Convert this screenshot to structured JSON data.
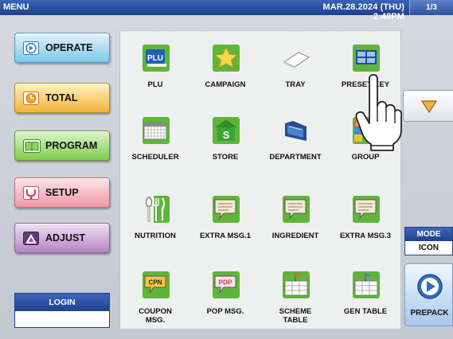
{
  "topbar": {
    "menu_label": "MENU",
    "datetime": "MAR.28.2024 (THU)  2:48PM",
    "page_indicator": "1/3"
  },
  "nav": {
    "operate": "OPERATE",
    "total": "TOTAL",
    "program": "PROGRAM",
    "setup": "SETUP",
    "adjust": "ADJUST"
  },
  "login": {
    "label": "LOGIN",
    "value": ""
  },
  "menu_items": [
    {
      "label": "PLU",
      "icon": "plu-icon",
      "icon_text": "PLU"
    },
    {
      "label": "CAMPAIGN",
      "icon": "star-icon"
    },
    {
      "label": "TRAY",
      "icon": "tray-icon"
    },
    {
      "label": "PRESET KEY",
      "icon": "preset-key-icon"
    },
    {
      "label": "SCHEDULER",
      "icon": "calendar-icon"
    },
    {
      "label": "STORE",
      "icon": "store-icon",
      "icon_text": "S"
    },
    {
      "label": "DEPARTMENT",
      "icon": "folder-icon"
    },
    {
      "label": "GROUP",
      "icon": "group-icon",
      "icon_text": "G"
    },
    {
      "label": "NUTRITION",
      "icon": "cutlery-icon"
    },
    {
      "label": "EXTRA MSG.1",
      "icon": "message-icon"
    },
    {
      "label": "INGREDIENT",
      "icon": "message-icon"
    },
    {
      "label": "EXTRA MSG.3",
      "icon": "message-icon"
    },
    {
      "label": "COUPON\nMSG.",
      "icon": "coupon-icon",
      "icon_text": "CPN"
    },
    {
      "label": "POP MSG.",
      "icon": "pop-icon",
      "icon_text": "POP"
    },
    {
      "label": "SCHEME\nTABLE",
      "icon": "scheme-table-icon"
    },
    {
      "label": "GEN TABLE",
      "icon": "gen-table-icon"
    }
  ],
  "mode": {
    "label": "MODE",
    "value": "ICON"
  },
  "prepack": {
    "label": "PREPACK"
  },
  "colors": {
    "header_blue": "#1f418d",
    "icon_green": "#5fb53a",
    "panel_bg": "#eef0ef"
  }
}
